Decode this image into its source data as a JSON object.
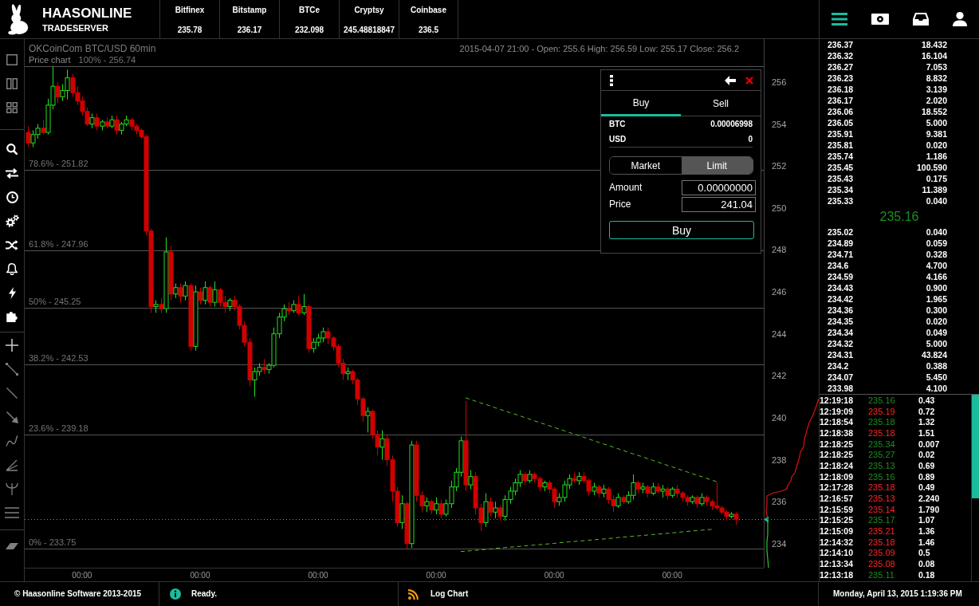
{
  "header": {
    "brand": "HAASONLINE",
    "product": "TRADESERVER",
    "tickers": [
      {
        "exchange": "Bitfinex",
        "price": "235.78"
      },
      {
        "exchange": "Bitstamp",
        "price": "236.17"
      },
      {
        "exchange": "BTCe",
        "price": "232.098"
      },
      {
        "exchange": "Cryptsy",
        "price": "245.48818847"
      },
      {
        "exchange": "Coinbase",
        "price": "236.5"
      }
    ]
  },
  "chart": {
    "title": "OKCoinCom BTC/USD 60min",
    "info": "2015-04-07 21:00 - Open: 255.6 High: 256.59 Low: 255.17 Close: 256.2",
    "chart_data": [
      {
        "type": "candlestick",
        "title": "Price chart",
        "categories": [
          null,
          null,
          null,
          null,
          null,
          null,
          null,
          null,
          null,
          null,
          null,
          "00:00",
          null,
          null,
          null,
          null,
          null,
          null,
          null,
          null,
          null,
          null,
          null,
          null,
          null,
          null,
          null,
          null,
          null,
          null,
          null,
          null,
          null,
          null,
          null,
          "00:00",
          null,
          null,
          null,
          null,
          null,
          null,
          null,
          null,
          null,
          null,
          null,
          null,
          null,
          null,
          null,
          null,
          null,
          null,
          null,
          null,
          null,
          null,
          null,
          "00:00",
          null,
          null,
          null,
          null,
          null,
          null,
          null,
          null,
          null,
          null,
          null,
          null,
          null,
          null,
          null,
          null,
          null,
          null,
          null,
          null,
          null,
          null,
          null,
          "00:00",
          null,
          null,
          null,
          null,
          null,
          null,
          null,
          null,
          null,
          null,
          null,
          null,
          null,
          null,
          null,
          null,
          null,
          null,
          null,
          null,
          null,
          null,
          null,
          "00:00",
          null,
          null,
          null,
          null,
          null,
          null,
          null,
          null,
          null,
          null,
          null,
          null,
          null,
          null,
          null,
          null,
          null,
          null,
          null,
          null,
          null,
          null,
          null,
          "00:00",
          null,
          null,
          null,
          null,
          null,
          null,
          null,
          null,
          null,
          null,
          null,
          null,
          null
        ],
        "ohlc": [
          [
            253.6,
            253.9,
            252.9,
            253.1
          ],
          [
            253.1,
            253.7,
            252.9,
            253.5
          ],
          [
            253.5,
            254.0,
            253.3,
            253.8
          ],
          [
            253.8,
            254.2,
            253.5,
            253.6
          ],
          [
            253.6,
            255.2,
            253.5,
            254.9
          ],
          [
            254.9,
            256.74,
            254.7,
            255.8
          ],
          [
            255.8,
            256.0,
            255.0,
            255.3
          ],
          [
            255.3,
            255.9,
            255.1,
            255.6
          ],
          [
            255.6,
            256.59,
            255.17,
            256.2
          ],
          [
            256.2,
            256.4,
            255.3,
            255.5
          ],
          [
            255.5,
            255.8,
            254.9,
            255.1
          ],
          [
            255.1,
            255.3,
            254.4,
            254.6
          ],
          [
            254.6,
            254.8,
            253.9,
            254.0
          ],
          [
            254.0,
            254.5,
            253.8,
            254.3
          ],
          [
            254.3,
            254.5,
            253.7,
            253.9
          ],
          [
            253.9,
            254.2,
            253.7,
            254.1
          ],
          [
            254.1,
            254.3,
            253.8,
            253.9
          ],
          [
            253.9,
            254.4,
            253.8,
            254.2
          ],
          [
            254.2,
            254.4,
            253.5,
            253.7
          ],
          [
            253.7,
            254.1,
            253.5,
            254.0
          ],
          [
            254.0,
            254.4,
            253.9,
            254.2
          ],
          [
            254.2,
            254.3,
            253.7,
            253.9
          ],
          [
            253.9,
            254.0,
            253.5,
            253.7
          ],
          [
            253.7,
            253.8,
            253.3,
            253.4
          ],
          [
            253.4,
            253.5,
            248.7,
            248.9
          ],
          [
            248.9,
            249.0,
            245.0,
            245.3
          ],
          [
            245.3,
            245.6,
            245.0,
            245.4
          ],
          [
            245.4,
            245.7,
            245.0,
            245.2
          ],
          [
            245.2,
            248.6,
            245.0,
            247.9
          ],
          [
            247.9,
            248.2,
            245.6,
            245.9
          ],
          [
            245.9,
            246.4,
            245.7,
            246.2
          ],
          [
            246.2,
            246.4,
            245.5,
            245.8
          ],
          [
            245.8,
            246.5,
            245.6,
            246.3
          ],
          [
            246.3,
            246.4,
            243.2,
            243.4
          ],
          [
            243.4,
            246.3,
            243.2,
            246.0
          ],
          [
            246.0,
            246.2,
            245.4,
            245.6
          ],
          [
            245.6,
            246.5,
            245.4,
            246.2
          ],
          [
            246.2,
            246.3,
            245.3,
            245.5
          ],
          [
            245.5,
            246.5,
            245.3,
            246.1
          ],
          [
            246.1,
            246.2,
            245.3,
            245.5
          ],
          [
            245.5,
            245.8,
            245.0,
            245.3
          ],
          [
            245.3,
            245.7,
            245.1,
            245.6
          ],
          [
            245.6,
            245.8,
            245.1,
            245.3
          ],
          [
            245.3,
            245.4,
            244.2,
            244.4
          ],
          [
            244.4,
            244.6,
            243.4,
            243.6
          ],
          [
            243.6,
            243.8,
            241.5,
            241.8
          ],
          [
            241.8,
            242.4,
            241.0,
            242.2
          ],
          [
            242.2,
            242.6,
            242.0,
            242.4
          ],
          [
            242.4,
            242.8,
            242.1,
            242.3
          ],
          [
            242.3,
            242.6,
            242.1,
            242.5
          ],
          [
            242.5,
            244.3,
            242.4,
            244.0
          ],
          [
            244.0,
            245.0,
            243.8,
            244.8
          ],
          [
            244.8,
            245.4,
            244.6,
            245.2
          ],
          [
            245.2,
            245.5,
            244.9,
            245.1
          ],
          [
            245.1,
            245.6,
            245.0,
            245.4
          ],
          [
            245.4,
            245.8,
            244.9,
            245.0
          ],
          [
            245.0,
            245.9,
            244.9,
            245.3
          ],
          [
            245.3,
            245.4,
            243.1,
            243.3
          ],
          [
            243.3,
            243.8,
            243.1,
            243.6
          ],
          [
            243.6,
            244.0,
            243.4,
            243.8
          ],
          [
            243.8,
            244.3,
            243.6,
            244.1
          ],
          [
            244.1,
            244.3,
            243.5,
            243.8
          ],
          [
            243.8,
            243.9,
            243.2,
            243.4
          ],
          [
            243.4,
            243.5,
            242.4,
            242.6
          ],
          [
            242.6,
            242.8,
            241.8,
            242.1
          ],
          [
            242.1,
            242.4,
            241.8,
            242.2
          ],
          [
            242.2,
            242.3,
            241.6,
            241.8
          ],
          [
            241.8,
            241.9,
            240.6,
            240.9
          ],
          [
            240.9,
            241.0,
            239.8,
            240.1
          ],
          [
            240.1,
            240.5,
            239.3,
            240.3
          ],
          [
            240.3,
            240.4,
            239.0,
            239.2
          ],
          [
            239.2,
            239.4,
            238.2,
            238.6
          ],
          [
            238.6,
            239.4,
            238.0,
            239.0
          ],
          [
            239.0,
            239.2,
            237.7,
            238.0
          ],
          [
            238.0,
            238.2,
            236.0,
            236.5
          ],
          [
            236.5,
            236.7,
            234.8,
            235.0
          ],
          [
            235.0,
            236.3,
            234.7,
            235.9
          ],
          [
            235.9,
            236.0,
            233.75,
            234.0
          ],
          [
            234.0,
            238.9,
            233.8,
            238.7
          ],
          [
            238.7,
            238.9,
            236.0,
            236.3
          ],
          [
            236.3,
            236.5,
            235.5,
            235.8
          ],
          [
            235.8,
            236.2,
            235.5,
            236.0
          ],
          [
            236.0,
            236.1,
            235.4,
            235.6
          ],
          [
            235.6,
            236.2,
            235.4,
            235.9
          ],
          [
            235.9,
            236.1,
            235.2,
            235.4
          ],
          [
            235.4,
            236.1,
            235.3,
            235.9
          ],
          [
            235.9,
            237.0,
            235.7,
            236.7
          ],
          [
            236.7,
            237.6,
            236.5,
            237.4
          ],
          [
            237.4,
            239.1,
            237.2,
            238.9
          ],
          [
            238.9,
            240.8,
            236.5,
            236.8
          ],
          [
            236.8,
            237.5,
            236.6,
            237.2
          ],
          [
            237.2,
            237.4,
            235.4,
            235.7
          ],
          [
            235.7,
            235.9,
            234.6,
            235.0
          ],
          [
            235.0,
            236.4,
            234.8,
            236.0
          ],
          [
            236.0,
            236.2,
            235.3,
            235.5
          ],
          [
            235.5,
            236.0,
            235.2,
            235.7
          ],
          [
            235.7,
            235.8,
            235.1,
            235.3
          ],
          [
            235.3,
            236.3,
            235.1,
            236.1
          ],
          [
            236.1,
            236.7,
            235.9,
            236.5
          ],
          [
            236.5,
            237.1,
            236.3,
            236.9
          ],
          [
            236.9,
            237.5,
            236.7,
            237.3
          ],
          [
            237.3,
            237.4,
            236.8,
            237.0
          ],
          [
            237.0,
            237.5,
            236.9,
            237.3
          ],
          [
            237.3,
            237.4,
            236.9,
            237.1
          ],
          [
            237.1,
            237.2,
            236.5,
            236.7
          ],
          [
            236.7,
            237.0,
            236.5,
            236.9
          ],
          [
            236.9,
            237.0,
            236.4,
            236.6
          ],
          [
            236.6,
            236.7,
            235.7,
            236.0
          ],
          [
            236.0,
            236.4,
            235.8,
            236.2
          ],
          [
            236.2,
            237.0,
            236.0,
            236.8
          ],
          [
            236.8,
            237.3,
            236.6,
            237.1
          ],
          [
            237.1,
            237.4,
            236.9,
            237.0
          ],
          [
            237.0,
            237.4,
            236.8,
            237.2
          ],
          [
            237.2,
            237.4,
            236.9,
            237.0
          ],
          [
            237.0,
            237.1,
            236.3,
            236.5
          ],
          [
            236.5,
            236.9,
            236.3,
            236.7
          ],
          [
            236.7,
            236.8,
            236.2,
            236.4
          ],
          [
            236.4,
            236.8,
            236.2,
            236.6
          ],
          [
            236.6,
            236.7,
            235.9,
            236.1
          ],
          [
            236.1,
            236.3,
            235.5,
            235.8
          ],
          [
            235.8,
            236.4,
            235.7,
            236.2
          ],
          [
            236.2,
            236.3,
            235.9,
            236.0
          ],
          [
            236.0,
            236.5,
            235.9,
            236.3
          ],
          [
            236.3,
            237.3,
            236.1,
            236.9
          ],
          [
            236.9,
            237.0,
            236.4,
            236.6
          ],
          [
            236.6,
            236.9,
            236.4,
            236.7
          ],
          [
            236.7,
            236.8,
            236.2,
            236.4
          ],
          [
            236.4,
            236.9,
            236.3,
            236.7
          ],
          [
            236.7,
            236.9,
            236.4,
            236.5
          ],
          [
            236.5,
            236.8,
            236.2,
            236.6
          ],
          [
            236.6,
            236.7,
            236.1,
            236.3
          ],
          [
            236.3,
            236.7,
            236.2,
            236.6
          ],
          [
            236.6,
            236.8,
            236.2,
            236.4
          ],
          [
            236.4,
            236.5,
            236.0,
            236.2
          ],
          [
            236.2,
            236.3,
            235.8,
            236.0
          ],
          [
            236.0,
            236.3,
            235.9,
            236.2
          ],
          [
            236.2,
            236.3,
            235.7,
            235.9
          ],
          [
            235.9,
            236.4,
            235.8,
            236.2
          ],
          [
            236.2,
            236.3,
            235.8,
            236.0
          ],
          [
            236.0,
            236.1,
            235.6,
            235.8
          ],
          [
            235.8,
            236.9,
            235.6,
            235.7
          ],
          [
            235.7,
            235.8,
            235.4,
            235.5
          ],
          [
            235.5,
            235.6,
            235.1,
            235.3
          ],
          [
            235.3,
            235.5,
            235.2,
            235.4
          ],
          [
            235.4,
            235.5,
            234.9,
            235.16
          ]
        ],
        "ylim": [
          232.85,
          258.05
        ],
        "yticks": [
          234,
          236,
          238,
          240,
          242,
          244,
          246,
          248,
          250,
          252,
          254,
          256
        ],
        "ref_lines": [
          {
            "axis": "y",
            "value": 256.74,
            "color": "#555555"
          },
          {
            "axis": "y",
            "value": 251.82,
            "color": "#555555"
          },
          {
            "axis": "y",
            "value": 247.96,
            "color": "#555555"
          },
          {
            "axis": "y",
            "value": 245.25,
            "color": "#555555"
          },
          {
            "axis": "y",
            "value": 242.53,
            "color": "#555555"
          },
          {
            "axis": "y",
            "value": 239.18,
            "color": "#555555"
          },
          {
            "axis": "y",
            "value": 233.75,
            "color": "#555555"
          },
          {
            "axis": "y",
            "value": 235.16,
            "color": "#1abc9c",
            "line_style": "dotted"
          }
        ],
        "annotations": [
          "100% - 256.74",
          "78.6% - 251.82",
          "61.8% - 247.96",
          "50% - 245.25",
          "38.2% - 242.53",
          "23.6% - 239.18",
          "0% - 233.75"
        ],
        "series": [
          {
            "type": "line",
            "line_style": "dashed",
            "color": "#5cbf2a",
            "values": [
              null,
              null,
              null,
              null,
              null,
              null,
              null,
              null,
              null,
              null,
              null,
              null,
              null,
              null,
              null,
              null,
              null,
              null,
              null,
              null,
              null,
              null,
              null,
              null,
              null,
              null,
              null,
              null,
              null,
              null,
              null,
              null,
              null,
              null,
              null,
              null,
              null,
              null,
              null,
              null,
              null,
              null,
              null,
              null,
              null,
              null,
              null,
              null,
              null,
              null,
              null,
              null,
              null,
              null,
              null,
              null,
              null,
              null,
              null,
              null,
              null,
              null,
              null,
              null,
              null,
              null,
              null,
              null,
              null,
              null,
              null,
              null,
              null,
              null,
              null,
              null,
              null,
              null,
              null,
              null,
              null,
              null,
              null,
              null,
              null,
              null,
              null,
              null,
              null,
              240.95,
              240.87,
              240.79,
              240.71,
              240.64,
              240.56,
              240.48,
              240.4,
              240.32,
              240.24,
              240.17,
              240.09,
              240.01,
              239.93,
              239.85,
              239.77,
              239.7,
              239.62,
              239.54,
              239.46,
              239.38,
              239.3,
              239.22,
              239.15,
              239.07,
              238.99,
              238.91,
              238.83,
              238.75,
              238.68,
              238.6,
              238.52,
              238.44,
              238.36,
              238.28,
              238.21,
              238.13,
              238.05,
              237.97,
              237.89,
              237.81,
              237.73,
              237.66,
              237.58,
              237.5,
              237.42,
              237.34,
              237.26,
              237.19,
              237.11,
              237.03,
              236.95,
              null,
              null,
              null,
              null
            ]
          },
          {
            "type": "line",
            "line_style": "dashed",
            "color": "#5cbf2a",
            "values": [
              null,
              null,
              null,
              null,
              null,
              null,
              null,
              null,
              null,
              null,
              null,
              null,
              null,
              null,
              null,
              null,
              null,
              null,
              null,
              null,
              null,
              null,
              null,
              null,
              null,
              null,
              null,
              null,
              null,
              null,
              null,
              null,
              null,
              null,
              null,
              null,
              null,
              null,
              null,
              null,
              null,
              null,
              null,
              null,
              null,
              null,
              null,
              null,
              null,
              null,
              null,
              null,
              null,
              null,
              null,
              null,
              null,
              null,
              null,
              null,
              null,
              null,
              null,
              null,
              null,
              null,
              null,
              null,
              null,
              null,
              null,
              null,
              null,
              null,
              null,
              null,
              null,
              null,
              null,
              null,
              null,
              null,
              null,
              null,
              null,
              null,
              null,
              null,
              233.62,
              233.64,
              233.66,
              233.68,
              233.7,
              233.72,
              233.74,
              233.77,
              233.79,
              233.81,
              233.83,
              233.85,
              233.87,
              233.89,
              233.91,
              233.93,
              233.95,
              233.97,
              233.99,
              234.01,
              234.04,
              234.06,
              234.08,
              234.1,
              234.12,
              234.14,
              234.16,
              234.18,
              234.2,
              234.22,
              234.24,
              234.26,
              234.29,
              234.31,
              234.33,
              234.35,
              234.37,
              234.39,
              234.41,
              234.43,
              234.45,
              234.47,
              234.49,
              234.51,
              234.53,
              234.56,
              234.58,
              234.6,
              234.62,
              234.64,
              234.66,
              234.68,
              null,
              null,
              null,
              null,
              null
            ]
          }
        ]
      }
    ]
  },
  "order_panel": {
    "tabs": [
      {
        "label": "Buy",
        "selected": true
      },
      {
        "label": "Sell",
        "selected": false
      }
    ],
    "balances": [
      {
        "currency": "BTC",
        "amount": "0.00006998"
      },
      {
        "currency": "USD",
        "amount": "0"
      }
    ],
    "order_types": [
      {
        "label": "Market",
        "selected": false
      },
      {
        "label": "Limit",
        "selected": true
      }
    ],
    "fields": [
      {
        "label": "Amount",
        "value": "0.00000000"
      },
      {
        "label": "Price",
        "value": "241.04"
      }
    ],
    "submit": "Buy"
  },
  "order_book": {
    "asks": [
      {
        "price": "236.37",
        "amount": "18.432"
      },
      {
        "price": "236.32",
        "amount": "16.104"
      },
      {
        "price": "236.27",
        "amount": "7.053"
      },
      {
        "price": "236.23",
        "amount": "8.832"
      },
      {
        "price": "236.18",
        "amount": "3.139"
      },
      {
        "price": "236.17",
        "amount": "2.020"
      },
      {
        "price": "236.06",
        "amount": "18.552"
      },
      {
        "price": "236.05",
        "amount": "5.000"
      },
      {
        "price": "235.91",
        "amount": "9.381"
      },
      {
        "price": "235.81",
        "amount": "0.020"
      },
      {
        "price": "235.74",
        "amount": "1.186"
      },
      {
        "price": "235.45",
        "amount": "100.590"
      },
      {
        "price": "235.43",
        "amount": "0.175"
      },
      {
        "price": "235.34",
        "amount": "11.389"
      },
      {
        "price": "235.33",
        "amount": "0.040"
      }
    ],
    "last_price": "235.16",
    "bids": [
      {
        "price": "235.02",
        "amount": "0.040"
      },
      {
        "price": "234.89",
        "amount": "0.059"
      },
      {
        "price": "234.71",
        "amount": "0.328"
      },
      {
        "price": "234.6",
        "amount": "4.700"
      },
      {
        "price": "234.59",
        "amount": "4.166"
      },
      {
        "price": "234.43",
        "amount": "0.900"
      },
      {
        "price": "234.42",
        "amount": "1.965"
      },
      {
        "price": "234.36",
        "amount": "0.300"
      },
      {
        "price": "234.35",
        "amount": "0.020"
      },
      {
        "price": "234.34",
        "amount": "0.049"
      },
      {
        "price": "234.32",
        "amount": "5.000"
      },
      {
        "price": "234.31",
        "amount": "43.824"
      },
      {
        "price": "234.2",
        "amount": "0.388"
      },
      {
        "price": "234.07",
        "amount": "5.450"
      },
      {
        "price": "233.98",
        "amount": "4.100"
      }
    ]
  },
  "trades": [
    {
      "time": "12:19:18",
      "price": "235.16",
      "amount": "0.43",
      "color": "#1e8c1e"
    },
    {
      "time": "12:19:09",
      "price": "235.19",
      "amount": "0.72",
      "color": "#ff2424"
    },
    {
      "time": "12:18:54",
      "price": "235.18",
      "amount": "1.32",
      "color": "#1e8c1e"
    },
    {
      "time": "12:18:38",
      "price": "235.18",
      "amount": "1.51",
      "color": "#ff2424"
    },
    {
      "time": "12:18:25",
      "price": "235.34",
      "amount": "0.007",
      "color": "#1e8c1e"
    },
    {
      "time": "12:18:25",
      "price": "235.27",
      "amount": "0.02",
      "color": "#1e8c1e"
    },
    {
      "time": "12:18:24",
      "price": "235.13",
      "amount": "0.69",
      "color": "#1e8c1e"
    },
    {
      "time": "12:18:09",
      "price": "235.16",
      "amount": "0.89",
      "color": "#1e8c1e"
    },
    {
      "time": "12:17:28",
      "price": "235.18",
      "amount": "0.49",
      "color": "#ff2424"
    },
    {
      "time": "12:16:57",
      "price": "235.13",
      "amount": "2.240",
      "color": "#ff2424"
    },
    {
      "time": "12:15:59",
      "price": "235.14",
      "amount": "1.790",
      "color": "#ff2424"
    },
    {
      "time": "12:15:25",
      "price": "235.17",
      "amount": "1.07",
      "color": "#1e8c1e"
    },
    {
      "time": "12:15:09",
      "price": "235.21",
      "amount": "1.36",
      "color": "#ff2424"
    },
    {
      "time": "12:14:32",
      "price": "235.18",
      "amount": "1.46",
      "color": "#ff2424"
    },
    {
      "time": "12:14:10",
      "price": "235.09",
      "amount": "0.5",
      "color": "#ff2424"
    },
    {
      "time": "12:13:34",
      "price": "235.08",
      "amount": "0.08",
      "color": "#ff2424"
    },
    {
      "time": "12:13:18",
      "price": "235.11",
      "amount": "0.18",
      "color": "#1e8c1e"
    }
  ],
  "status_bar": {
    "copyright": "© Haasonline Software 2013-2015",
    "status": "Ready.",
    "log": "Log Chart",
    "datetime": "Monday, April 13, 2015 1:19:36 PM"
  }
}
